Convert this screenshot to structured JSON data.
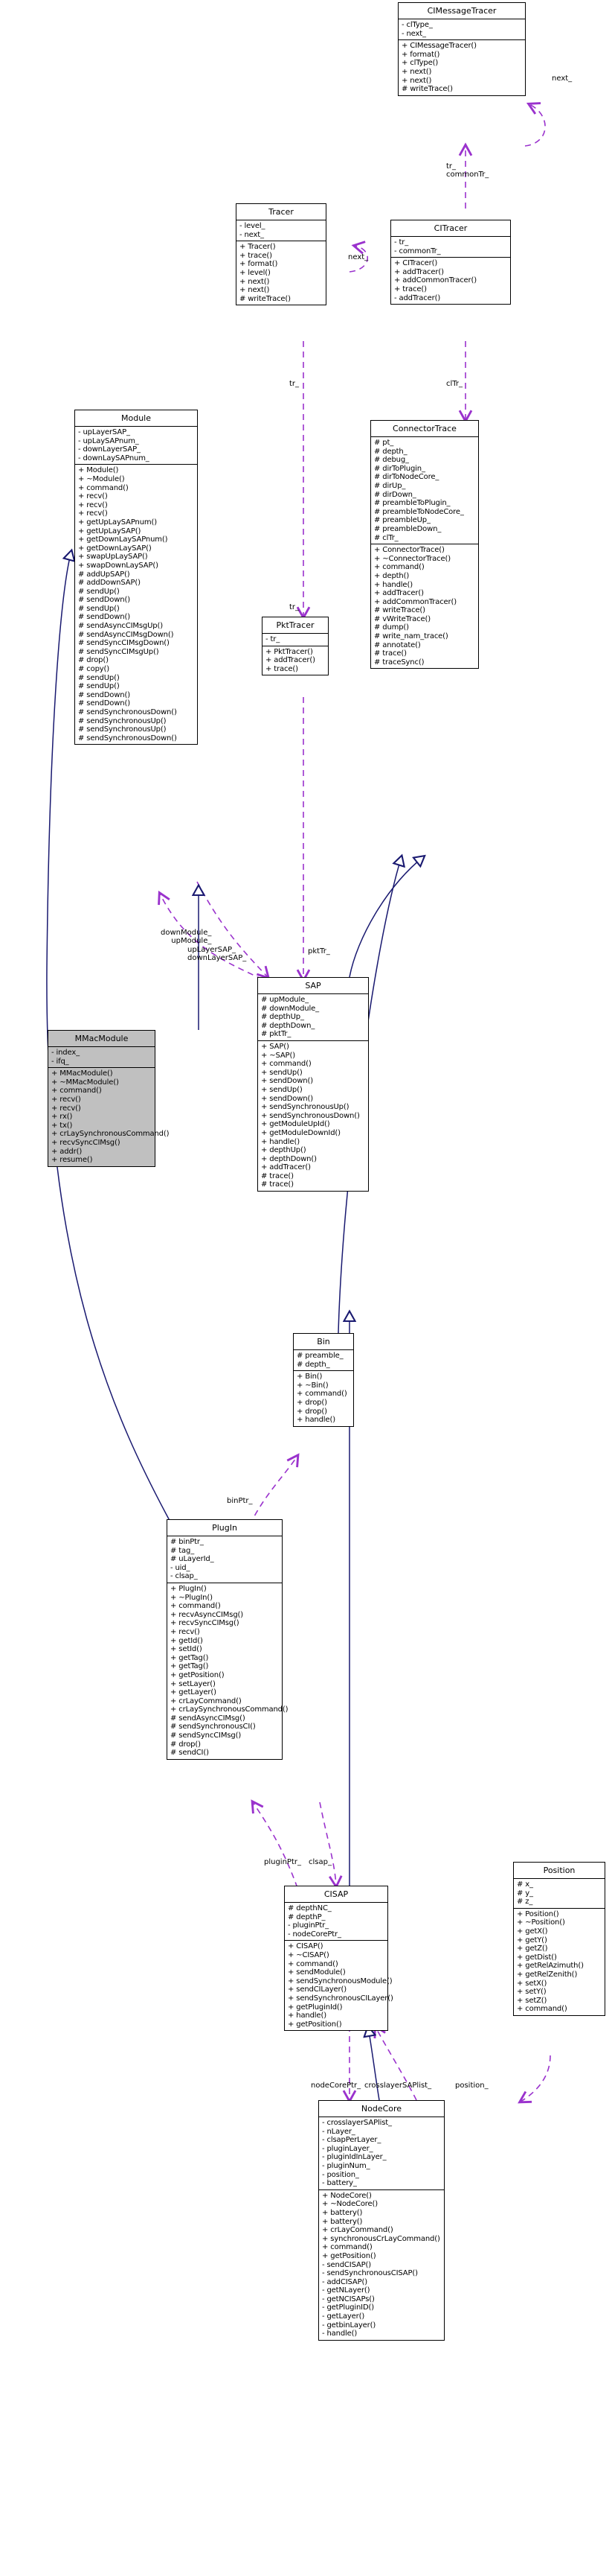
{
  "diagram": {
    "kind": "uml-class-diagram",
    "style": "doxygen-collaboration-graph",
    "colors": {
      "border": "#000000",
      "inheritance_edge": "#191970",
      "association_edge": "#9a32cd",
      "highlight_fill": "#c0c0c0",
      "background": "#ffffff"
    }
  },
  "classes": [
    {
      "id": "cimessagetracer",
      "name": "CIMessageTracer",
      "attributes": [
        "- clType_",
        "- next_"
      ],
      "methods": [
        "+ CIMessageTracer()",
        "+ format()",
        "+ clType()",
        "+ next()",
        "+ next()",
        "# writeTrace()"
      ]
    },
    {
      "id": "tracer",
      "name": "Tracer",
      "attributes": [
        "- level_",
        "- next_"
      ],
      "methods": [
        "+ Tracer()",
        "+ trace()",
        "+ format()",
        "+ level()",
        "+ next()",
        "+ next()",
        "# writeTrace()"
      ]
    },
    {
      "id": "citracer",
      "name": "CITracer",
      "attributes": [
        "- tr_",
        "- commonTr_"
      ],
      "methods": [
        "+ CITracer()",
        "+ addTracer()",
        "+ addCommonTracer()",
        "+ trace()",
        "- addTracer()"
      ]
    },
    {
      "id": "module",
      "name": "Module",
      "attributes": [
        "- upLayerSAP_",
        "- upLaySAPnum_",
        "- downLayerSAP_",
        "- downLaySAPnum_"
      ],
      "methods": [
        "+ Module()",
        "+ ~Module()",
        "+ command()",
        "+ recv()",
        "+ recv()",
        "+ recv()",
        "+ getUpLaySAPnum()",
        "+ getUpLaySAP()",
        "+ getDownLaySAPnum()",
        "+ getDownLaySAP()",
        "+ swapUpLaySAP()",
        "+ swapDownLaySAP()",
        "# addUpSAP()",
        "# addDownSAP()",
        "# sendUp()",
        "# sendDown()",
        "# sendUp()",
        "# sendDown()",
        "# sendAsyncCIMsgUp()",
        "# sendAsyncCIMsgDown()",
        "# sendSyncCIMsgDown()",
        "# sendSyncCIMsgUp()",
        "# drop()",
        "# copy()",
        "# sendUp()",
        "# sendUp()",
        "# sendDown()",
        "# sendDown()",
        "# sendSynchronousDown()",
        "# sendSynchronousUp()",
        "# sendSynchronousUp()",
        "# sendSynchronousDown()"
      ]
    },
    {
      "id": "pkttracer",
      "name": "PktTracer",
      "attributes": [
        "- tr_"
      ],
      "methods": [
        "+ PktTracer()",
        "+ addTracer()",
        "+ trace()"
      ]
    },
    {
      "id": "connectortrace",
      "name": "ConnectorTrace",
      "attributes": [
        "# pt_",
        "# depth_",
        "# debug_",
        "# dirToPlugin_",
        "# dirToNodeCore_",
        "# dirUp_",
        "# dirDown_",
        "# preambleToPlugin_",
        "# preambleToNodeCore_",
        "# preambleUp_",
        "# preambleDown_",
        "# clTr_"
      ],
      "methods": [
        "+ ConnectorTrace()",
        "+ ~ConnectorTrace()",
        "+ command()",
        "+ depth()",
        "+ handle()",
        "+ addTracer()",
        "+ addCommonTracer()",
        "# writeTrace()",
        "# vWriteTrace()",
        "# dump()",
        "# write_nam_trace()",
        "# annotate()",
        "# trace()",
        "# traceSync()"
      ]
    },
    {
      "id": "mmacmodule",
      "name": "MMacModule",
      "highlight": true,
      "attributes": [
        "- index_",
        "- ifq_"
      ],
      "methods": [
        "+ MMacModule()",
        "+ ~MMacModule()",
        "+ command()",
        "+ recv()",
        "+ recv()",
        "+ rx()",
        "+ tx()",
        "+ crLaySynchronousCommand()",
        "+ recvSyncCIMsg()",
        "+ addr()",
        "+ resume()"
      ]
    },
    {
      "id": "sap",
      "name": "SAP",
      "attributes": [
        "# upModule_",
        "# downModule_",
        "# depthUp_",
        "# depthDown_",
        "# pktTr_"
      ],
      "methods": [
        "+ SAP()",
        "+ ~SAP()",
        "+ command()",
        "+ sendUp()",
        "+ sendDown()",
        "+ sendUp()",
        "+ sendDown()",
        "+ sendSynchronousUp()",
        "+ sendSynchronousDown()",
        "+ getModuleUpId()",
        "+ getModuleDownId()",
        "+ handle()",
        "+ depthUp()",
        "+ depthDown()",
        "+ addTracer()",
        "# trace()",
        "# trace()"
      ]
    },
    {
      "id": "bin",
      "name": "Bin",
      "attributes": [
        "# preamble_",
        "# depth_"
      ],
      "methods": [
        "+ Bin()",
        "+ ~Bin()",
        "+ command()",
        "+ drop()",
        "+ drop()",
        "+ handle()"
      ]
    },
    {
      "id": "plugin",
      "name": "PlugIn",
      "attributes": [
        "# binPtr_",
        "# tag_",
        "# uLayerId_",
        "- uid_",
        "- clsap_"
      ],
      "methods": [
        "+ PlugIn()",
        "+ ~PlugIn()",
        "+ command()",
        "+ recvAsyncCIMsg()",
        "+ recvSyncCIMsg()",
        "+ recv()",
        "+ getId()",
        "+ setId()",
        "+ getTag()",
        "+ getTag()",
        "+ getPosition()",
        "+ setLayer()",
        "+ getLayer()",
        "+ crLayCommand()",
        "+ crLaySynchronousCommand()",
        "# sendAsyncCIMsg()",
        "# sendSynchronousCI()",
        "# sendSyncCIMsg()",
        "# drop()",
        "# sendCI()"
      ]
    },
    {
      "id": "cisap",
      "name": "CISAP",
      "attributes": [
        "# depthNC_",
        "# depthP_",
        "- pluginPtr_",
        "- nodeCorePtr_"
      ],
      "methods": [
        "+ CISAP()",
        "+ ~CISAP()",
        "+ command()",
        "+ sendModule()",
        "+ sendSynchronousModule()",
        "+ sendCILayer()",
        "+ sendSynchronousCILayer()",
        "+ getPluginId()",
        "+ handle()",
        "+ getPosition()"
      ]
    },
    {
      "id": "position",
      "name": "Position",
      "attributes": [
        "# x_",
        "# y_",
        "# z_"
      ],
      "methods": [
        "+ Position()",
        "+ ~Position()",
        "+ getX()",
        "+ getY()",
        "+ getZ()",
        "+ getDist()",
        "+ getRelAzimuth()",
        "+ getRelZenith()",
        "+ setX()",
        "+ setY()",
        "+ setZ()",
        "+ command()"
      ]
    },
    {
      "id": "nodecore",
      "name": "NodeCore",
      "attributes": [
        "- crosslayerSAPlist_",
        "- nLayer_",
        "- clsapPerLayer_",
        "- pluginLayer_",
        "- pluginIdInLayer_",
        "- pluginNum_",
        "- position_",
        "- battery_"
      ],
      "methods": [
        "+ NodeCore()",
        "+ ~NodeCore()",
        "+ battery()",
        "+ battery()",
        "+ crLayCommand()",
        "+ synchronousCrLayCommand()",
        "+ command()",
        "+ getPosition()",
        "- sendCISAP()",
        "- sendSynchronousCISAP()",
        "- addCISAP()",
        "- getNLayer()",
        "- getNCISAPs()",
        "- getPluginID()",
        "- getLayer()",
        "- getbinLayer()",
        "- handle()"
      ]
    }
  ],
  "edge_labels": [
    {
      "id": "next_top",
      "text": "next_"
    },
    {
      "id": "commontr",
      "text": "tr_\ncommonTr_"
    },
    {
      "id": "next_tracer",
      "text": "next_"
    },
    {
      "id": "tr_module",
      "text": "tr_"
    },
    {
      "id": "cltr",
      "text": "clTr_"
    },
    {
      "id": "tr_pkt",
      "text": "tr_"
    },
    {
      "id": "downupmodule",
      "text": "downModule_\nupModule_"
    },
    {
      "id": "uplaydownlay",
      "text": "upLayerSAP_\ndownLayerSAP_"
    },
    {
      "id": "pkttr",
      "text": "pktTr_"
    },
    {
      "id": "binptr",
      "text": "binPtr_"
    },
    {
      "id": "pluginptr",
      "text": "pluginPtr_"
    },
    {
      "id": "clsap",
      "text": "clsap_"
    },
    {
      "id": "nodecoreptr",
      "text": "nodeCorePtr_"
    },
    {
      "id": "crosslayer",
      "text": "crosslayerSAPlist_"
    },
    {
      "id": "position_lbl",
      "text": "position_"
    }
  ]
}
